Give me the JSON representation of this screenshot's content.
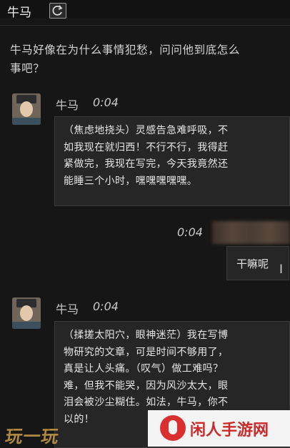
{
  "header": {
    "title": "牛马"
  },
  "prompt": {
    "line1": "牛马好像在为什么事情犯愁，问问他到底怎么",
    "line2": "事吧？"
  },
  "messages": [
    {
      "sender": "牛马",
      "time": "0:04",
      "lines": [
        "（焦虑地挠头）灵感告急难呼吸，不",
        "如我现在就归西！不行不行，我得赶",
        "紧做完，我现在写完，今天我竟然还",
        "能睡三个小时，嘿嘿嘿嘿嘿。"
      ]
    },
    {
      "sender": "牛马",
      "time": "0:04",
      "lines": [
        "（揉搓太阳穴，眼神迷茫）我在写博",
        "物研究的文章，可是时间不够用了，",
        "真是让人头痛。（叹气）做工难吗？",
        "难，但我不能哭，因为风沙太大，眼",
        "泪会被沙尘糊住。如法，牛马，你不",
        "以的！"
      ]
    }
  ],
  "reply": {
    "time": "0:04",
    "text": "干嘛呢"
  },
  "watermarks": {
    "left": "玩一玩",
    "right": "闲人手游网"
  },
  "colors": {
    "background": "#161616",
    "bubble": "#262626",
    "accent_red": "#cc2a2a",
    "accent_gold": "#b08a40"
  }
}
